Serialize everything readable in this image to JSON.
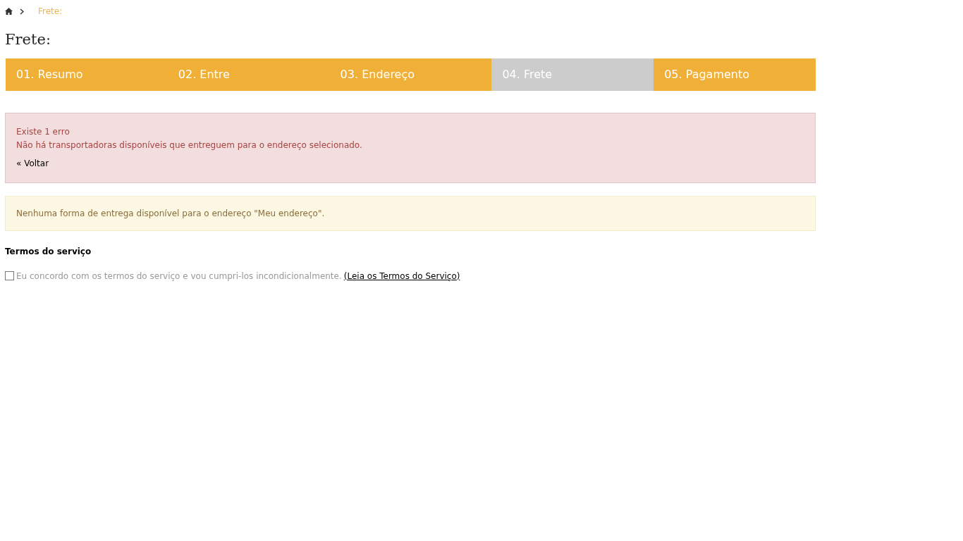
{
  "breadcrumb": {
    "current": "Frete:"
  },
  "page_title": "Frete:",
  "steps": [
    {
      "label": "01. Resumo",
      "selected": false
    },
    {
      "label": "02. Entre",
      "selected": false
    },
    {
      "label": "03. Endereço",
      "selected": false
    },
    {
      "label": "04. Frete",
      "selected": true
    },
    {
      "label": "05. Pagamento",
      "selected": false
    }
  ],
  "error_alert": {
    "heading": "Existe 1 erro",
    "message": "Não há transportadoras disponíveis que entreguem para o endereço selecionado.",
    "back_link": "« Voltar"
  },
  "warning_alert": {
    "message": "Nenhuma forma de entrega disponível para o endereço \"Meu endereço\"."
  },
  "terms": {
    "heading": "Termos do serviço",
    "checked": false,
    "label": "Eu concordo com os termos do serviço e vou cumpri-los incondicionalmente.",
    "link": "(Leia os Termos do Serviço)"
  }
}
